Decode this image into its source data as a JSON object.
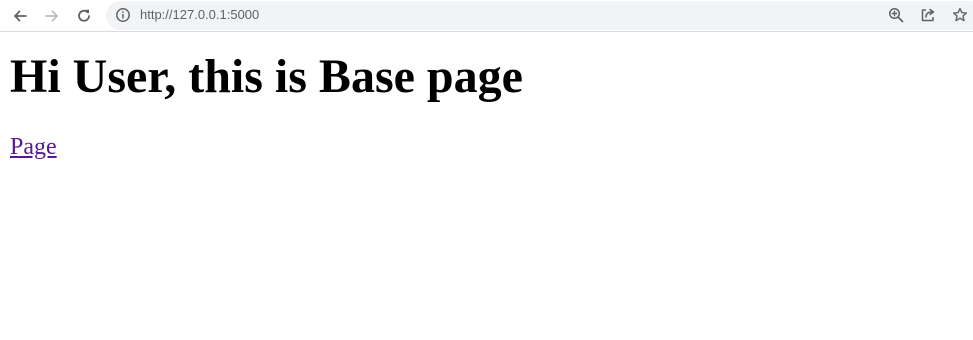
{
  "browser": {
    "address_bar": {
      "url": "http://127.0.0.1:5000"
    },
    "icons": {
      "back": "back-arrow-icon",
      "forward": "forward-arrow-icon",
      "reload": "reload-icon",
      "site_info": "info-icon",
      "zoom": "zoom-in-icon",
      "share": "share-icon",
      "bookmark": "star-icon"
    },
    "colors": {
      "toolbar_icon": "#5f6368",
      "toolbar_icon_disabled": "#b9bcc0",
      "omnibox_bg": "#f1f3f4"
    }
  },
  "page": {
    "heading": "Hi User, this is Base page",
    "link_label": "Page",
    "colors": {
      "text": "#000000",
      "visited_link": "#551a8b"
    }
  }
}
